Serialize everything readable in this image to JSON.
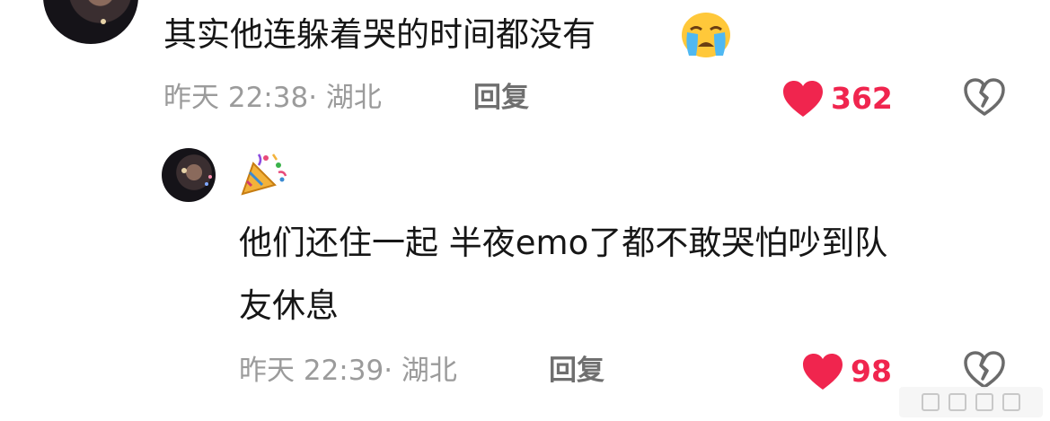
{
  "comment": {
    "text": "其实他连躲着哭的时间都没有",
    "emoji_icon": "loudly-crying-face",
    "timestamp": "昨天 22:38· 湖北",
    "reply_label": "回复",
    "like_count": "362"
  },
  "reply": {
    "username_icon": "party-popper",
    "text_line1": "他们还住一起 半夜emo了都不敢哭怕吵到队",
    "text_line2": "友休息",
    "timestamp": "昨天 22:39· 湖北",
    "reply_label": "回复",
    "like_count": "98"
  },
  "colors": {
    "like": "#f0254e",
    "meta": "#9b9b9b",
    "text": "#161616"
  }
}
